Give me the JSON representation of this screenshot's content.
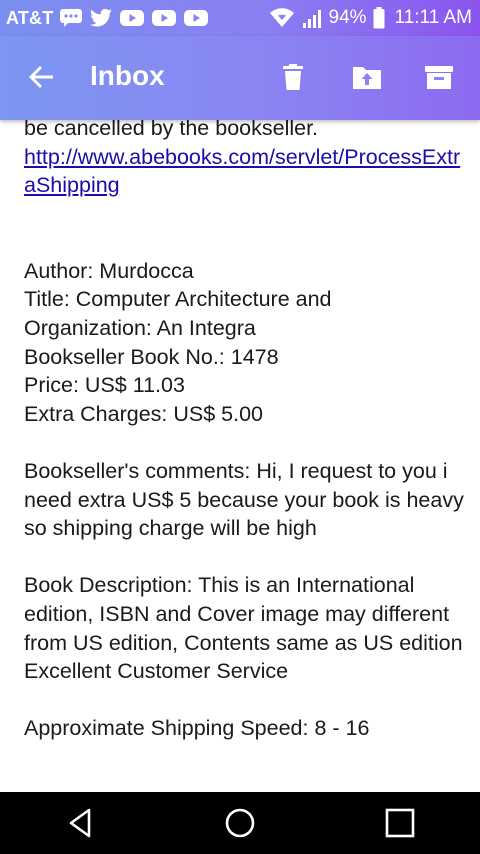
{
  "status_bar": {
    "carrier": "AT&T",
    "notification_icons": [
      "message-icon",
      "twitter-icon",
      "youtube-icon",
      "youtube-icon",
      "youtube-icon"
    ],
    "battery_percent": "94%",
    "time": "11:11 AM"
  },
  "app_bar": {
    "title": "Inbox",
    "actions": [
      "delete-icon",
      "move-to-folder-icon",
      "archive-icon"
    ]
  },
  "email_body": {
    "line_cancel": "be cancelled by the bookseller.",
    "link": "http://www.abebooks.com/servlet/ProcessExtraShipping",
    "author": "Author: Murdocca",
    "title_line": "Title: Computer Architecture and Organization: An Integra",
    "book_no": "Bookseller Book No.: 1478",
    "price": "Price: US$ 11.03",
    "extra_charges": "Extra Charges: US$ 5.00",
    "comments": "Bookseller's comments: Hi, I request to you i need extra US$ 5 because your book is heavy so shipping charge will be high",
    "description": "Book Description: This is an International edition, ISBN and Cover image may different from US edition, Contents same as US edition Excellent Customer Service",
    "shipping_speed": "Approximate Shipping Speed: 8 - 16"
  },
  "colors": {
    "status_bar": "#8b80f2",
    "app_bar": "#8a85f3",
    "link": "#1a0dab",
    "nav_bar": "#000000"
  }
}
